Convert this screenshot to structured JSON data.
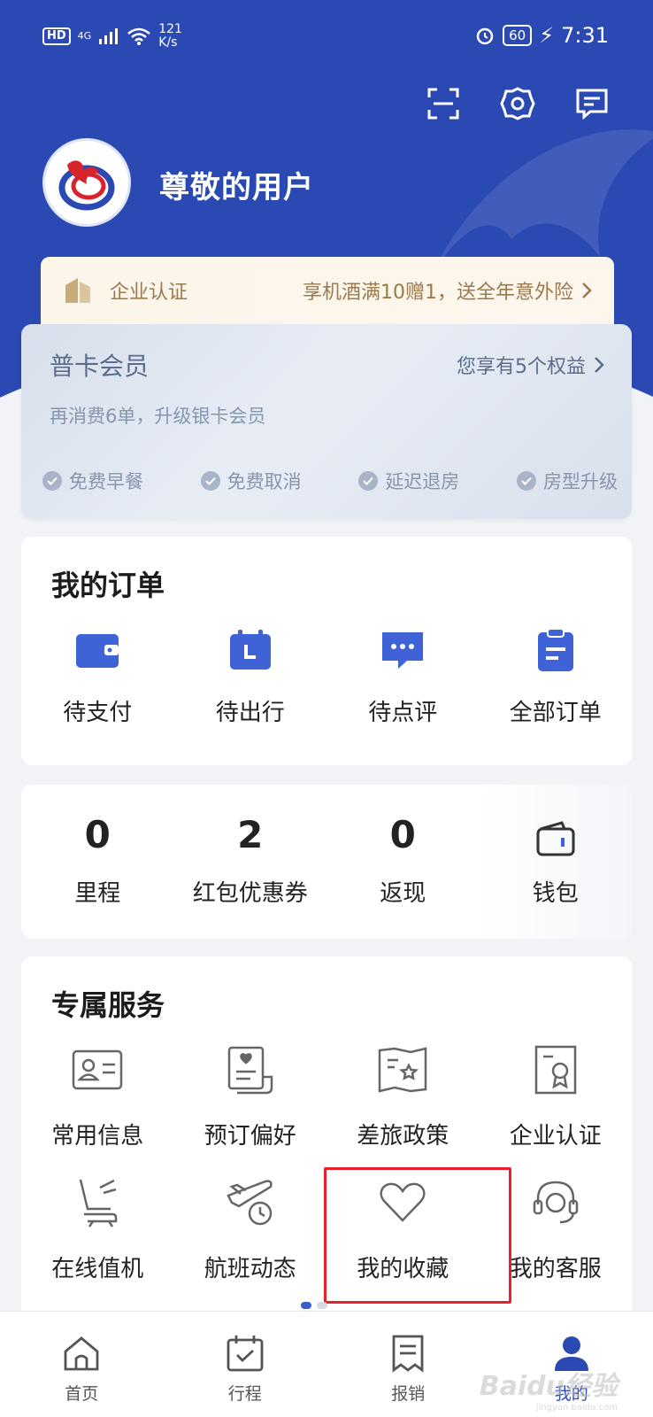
{
  "status_bar": {
    "hd": "HD",
    "network": "4G",
    "speed": "121\nK/s",
    "battery": "60",
    "time": "7:31"
  },
  "header": {
    "actions": [
      "scan-icon",
      "gear-icon",
      "message-icon"
    ],
    "username": "尊敬的用户"
  },
  "enterprise_banner": {
    "title": "企业认证",
    "promo": "享机酒满10赠1，送全年意外险"
  },
  "member": {
    "level": "普卡会员",
    "benefits_link": "您享有5个权益",
    "subtitle": "再消费6单，升级银卡会员",
    "perks": [
      "免费早餐",
      "免费取消",
      "延迟退房",
      "房型升级"
    ]
  },
  "orders": {
    "title": "我的订单",
    "items": [
      {
        "label": "待支付",
        "icon": "wallet-icon"
      },
      {
        "label": "待出行",
        "icon": "calendar-icon"
      },
      {
        "label": "待点评",
        "icon": "comment-icon"
      },
      {
        "label": "全部订单",
        "icon": "clipboard-icon"
      }
    ]
  },
  "stats": {
    "items": [
      {
        "value": "0",
        "label": "里程"
      },
      {
        "value": "2",
        "label": "红包优惠券"
      },
      {
        "value": "0",
        "label": "返现"
      }
    ],
    "wallet_label": "钱包"
  },
  "services": {
    "title": "专属服务",
    "row1": [
      {
        "label": "常用信息",
        "icon": "id-card-icon"
      },
      {
        "label": "预订偏好",
        "icon": "preference-icon"
      },
      {
        "label": "差旅政策",
        "icon": "policy-map-icon"
      },
      {
        "label": "企业认证",
        "icon": "certificate-icon"
      }
    ],
    "row2": [
      {
        "label": "在线值机",
        "icon": "seat-checkin-icon"
      },
      {
        "label": "航班动态",
        "icon": "flight-status-icon"
      },
      {
        "label": "我的收藏",
        "icon": "heart-icon"
      },
      {
        "label": "我的客服",
        "icon": "headset-icon"
      }
    ]
  },
  "tabbar": {
    "tabs": [
      {
        "label": "首页",
        "icon": "home-icon"
      },
      {
        "label": "行程",
        "icon": "itinerary-icon"
      },
      {
        "label": "报销",
        "icon": "receipt-icon"
      },
      {
        "label": "我的",
        "icon": "user-icon"
      }
    ],
    "active": "我的"
  },
  "watermark": {
    "text": "Baidu经验",
    "sub": "jingyan.baidu.com"
  },
  "colors": {
    "brand": "#2b49b3",
    "accent_icon": "#3f63d6",
    "gold": "#9b7a4e",
    "highlight": "#e8202a"
  }
}
